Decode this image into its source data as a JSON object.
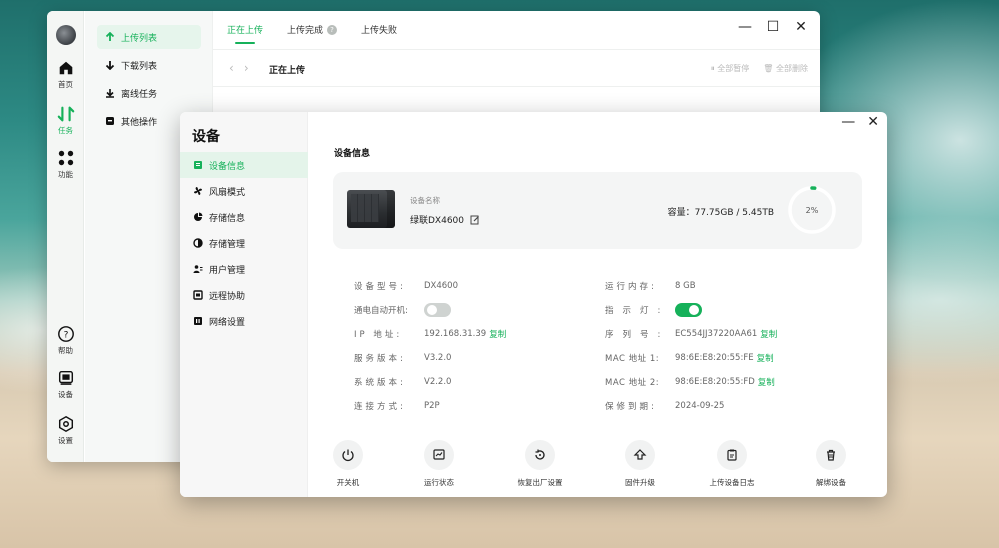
{
  "back_window": {
    "rail": [
      {
        "label": "首页",
        "icon": "home-icon"
      },
      {
        "label": "任务",
        "icon": "transfer-icon"
      },
      {
        "label": "功能",
        "icon": "grid-icon"
      },
      {
        "label": "帮助",
        "icon": "help-icon"
      },
      {
        "label": "设备",
        "icon": "device-icon"
      },
      {
        "label": "设置",
        "icon": "settings-icon"
      }
    ],
    "subnav": [
      {
        "label": "上传列表",
        "icon": "upload-icon"
      },
      {
        "label": "下载列表",
        "icon": "download-icon"
      },
      {
        "label": "离线任务",
        "icon": "offline-task-icon"
      },
      {
        "label": "其他操作",
        "icon": "other-icon"
      }
    ],
    "tabs": [
      {
        "label": "正在上传"
      },
      {
        "label": "上传完成"
      },
      {
        "label": "上传失败"
      }
    ],
    "window_controls": {
      "minimize": "—",
      "maximize": "☐",
      "close": "✕"
    },
    "bar_title": "正在上传",
    "pause_all": "全部暂停",
    "delete_all": "全部删除"
  },
  "front_window": {
    "title": "设备",
    "window_controls": {
      "minimize": "—",
      "close": "✕"
    },
    "side_items": [
      {
        "label": "设备信息",
        "icon": "device-info-icon"
      },
      {
        "label": "风扇模式",
        "icon": "fan-icon"
      },
      {
        "label": "存储信息",
        "icon": "storage-info-icon"
      },
      {
        "label": "存储管理",
        "icon": "storage-manage-icon"
      },
      {
        "label": "用户管理",
        "icon": "users-icon"
      },
      {
        "label": "远程协助",
        "icon": "remote-icon"
      },
      {
        "label": "网络设置",
        "icon": "network-icon"
      }
    ],
    "section_title": "设备信息",
    "device": {
      "name_label": "设备名称",
      "name": "绿联DX4600",
      "capacity_text": "容量：77.75GB / 5.45TB",
      "usage_percent": 2,
      "usage_text": "2%"
    },
    "info_left": [
      {
        "key": "设备型号:",
        "value": "DX4600"
      },
      {
        "key": "通电自动开机:",
        "value": "",
        "toggle": "off"
      },
      {
        "key": "IP 地址:",
        "value": "192.168.31.39",
        "copy": "复制"
      },
      {
        "key": "服务版本:",
        "value": "V3.2.0"
      },
      {
        "key": "系统版本:",
        "value": "V2.2.0"
      },
      {
        "key": "连接方式:",
        "value": "P2P"
      }
    ],
    "info_right": [
      {
        "key": "运行内存:",
        "value": "8 GB"
      },
      {
        "key": "指示灯:",
        "value": "",
        "toggle": "on"
      },
      {
        "key": "序列号:",
        "value": "EC554JJ37220AA61",
        "copy": "复制"
      },
      {
        "key": "MAC 地址 1:",
        "value": "98:6E:E8:20:55:FE",
        "copy": "复制"
      },
      {
        "key": "MAC 地址 2:",
        "value": "98:6E:E8:20:55:FD",
        "copy": "复制"
      },
      {
        "key": "保修到期:",
        "value": "2024-09-25"
      }
    ],
    "actions": [
      {
        "label": "开关机",
        "icon": "power-icon"
      },
      {
        "label": "运行状态",
        "icon": "status-monitor-icon"
      },
      {
        "label": "恢复出厂设置",
        "icon": "factory-reset-icon"
      },
      {
        "label": "固件升级",
        "icon": "firmware-upgrade-icon"
      },
      {
        "label": "上传设备日志",
        "icon": "upload-log-icon"
      },
      {
        "label": "解绑设备",
        "icon": "unbind-device-icon"
      }
    ]
  },
  "colors": {
    "accent": "#16b15a"
  }
}
